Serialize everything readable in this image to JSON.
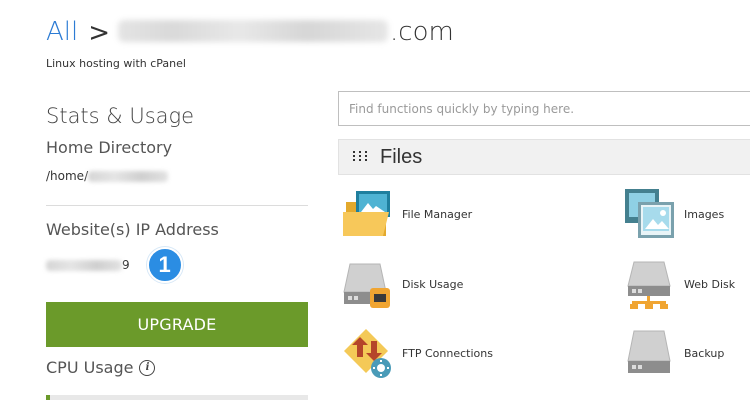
{
  "header": {
    "breadcrumb_root": "All",
    "breadcrumb_separator": ">",
    "domain_suffix": ".com",
    "subtitle": "Linux hosting with cPanel"
  },
  "stats": {
    "title": "Stats & Usage",
    "home_directory_label": "Home Directory",
    "home_directory_prefix": "/home/",
    "ip_label": "Website(s) IP Address",
    "ip_visible_suffix": "9",
    "step_badge": "1",
    "upgrade_label": "UPGRADE",
    "cpu_label": "CPU Usage",
    "info_glyph": "i"
  },
  "search": {
    "placeholder": "Find functions quickly by typing here."
  },
  "files": {
    "title": "Files",
    "items": [
      {
        "label": "File Manager",
        "icon": "file-manager-icon"
      },
      {
        "label": "Images",
        "icon": "images-icon"
      },
      {
        "label": "Disk Usage",
        "icon": "disk-usage-icon"
      },
      {
        "label": "Web Disk",
        "icon": "web-disk-icon"
      },
      {
        "label": "FTP Connections",
        "icon": "ftp-connections-icon"
      },
      {
        "label": "Backup",
        "icon": "backup-icon"
      }
    ]
  },
  "colors": {
    "accent_blue": "#2c7bd4",
    "upgrade_green": "#6b9a2a",
    "badge_blue": "#2b8de3"
  }
}
